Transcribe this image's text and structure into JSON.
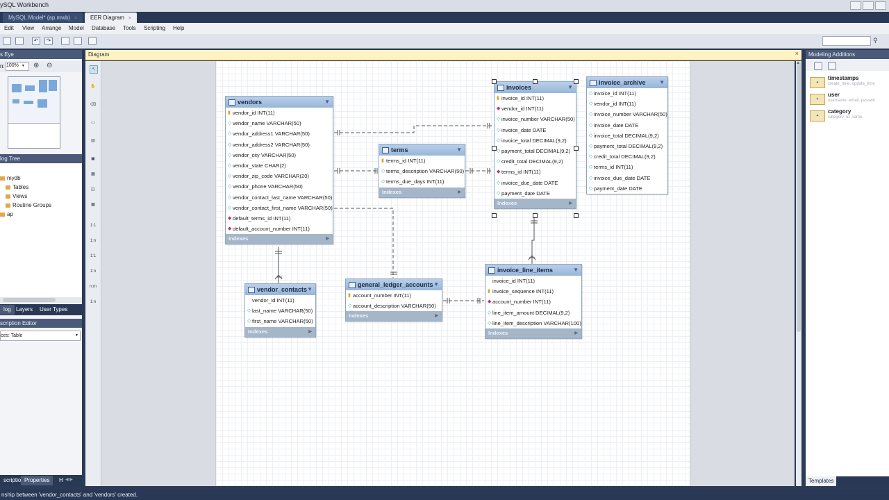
{
  "window": {
    "title": "ySQL Workbench"
  },
  "tabs": [
    {
      "label": "MySQL Model* (ap.mwb)",
      "close": "×"
    },
    {
      "label": "EER Diagram",
      "close": "×"
    }
  ],
  "menu": [
    "Edit",
    "View",
    "Arrange",
    "Model",
    "Database",
    "Tools",
    "Scripting",
    "Help"
  ],
  "left": {
    "birds_eye": "s Eye",
    "zoom_label": "n:",
    "zoom": "100%",
    "catalog_tree": "log Tree",
    "tree": [
      "mydb",
      "Tables",
      "Views",
      "Routine Groups",
      "ap"
    ],
    "bottom_tabs": [
      "log",
      "Layers",
      "User Types"
    ],
    "desc_editor": "scription Editor",
    "desc_select": "ces: Table",
    "footer_tabs": [
      "scription",
      "Properties",
      "H"
    ]
  },
  "diagram": {
    "header": "Diagram"
  },
  "tables": {
    "vendors": {
      "name": "vendors",
      "cols": [
        {
          "k": "pk",
          "t": "vendor_id INT(11)"
        },
        {
          "k": "c",
          "t": "vendor_name VARCHAR(50)"
        },
        {
          "k": "c",
          "t": "vendor_address1 VARCHAR(50)"
        },
        {
          "k": "c",
          "t": "vendor_address2 VARCHAR(50)"
        },
        {
          "k": "c",
          "t": "vendor_city VARCHAR(50)"
        },
        {
          "k": "c",
          "t": "vendor_state CHAR(2)"
        },
        {
          "k": "c",
          "t": "vendor_zip_code VARCHAR(20)"
        },
        {
          "k": "c",
          "t": "vendor_phone VARCHAR(50)"
        },
        {
          "k": "c",
          "t": "vendor_contact_last_name VARCHAR(50)"
        },
        {
          "k": "c",
          "t": "vendor_contact_first_name VARCHAR(50)"
        },
        {
          "k": "fk",
          "t": "default_terms_id INT(11)"
        },
        {
          "k": "fk",
          "t": "default_account_number INT(11)"
        }
      ]
    },
    "terms": {
      "name": "terms",
      "cols": [
        {
          "k": "pk",
          "t": "terms_id INT(11)"
        },
        {
          "k": "c",
          "t": "terms_description VARCHAR(50)"
        },
        {
          "k": "c",
          "t": "terms_due_days INT(11)"
        }
      ]
    },
    "invoices": {
      "name": "invoices",
      "cols": [
        {
          "k": "pk",
          "t": "invoice_id INT(11)"
        },
        {
          "k": "fk",
          "t": "vendor_id INT(11)"
        },
        {
          "k": "c",
          "t": "invoice_number VARCHAR(50)"
        },
        {
          "k": "c",
          "t": "invoice_date DATE"
        },
        {
          "k": "c",
          "t": "invoice_total DECIMAL(9,2)"
        },
        {
          "k": "c",
          "t": "payment_total DECIMAL(9,2)"
        },
        {
          "k": "c",
          "t": "credit_total DECIMAL(9,2)"
        },
        {
          "k": "fk",
          "t": "terms_id INT(11)"
        },
        {
          "k": "c",
          "t": "invoice_due_date DATE"
        },
        {
          "k": "c",
          "t": "payment_date DATE"
        }
      ]
    },
    "invoice_archive": {
      "name": "invoice_archive",
      "cols": [
        {
          "k": "c",
          "t": "invoice_id INT(11)"
        },
        {
          "k": "c",
          "t": "vendor_id INT(11)"
        },
        {
          "k": "c",
          "t": "invoice_number VARCHAR(50)"
        },
        {
          "k": "c",
          "t": "invoice_date DATE"
        },
        {
          "k": "c",
          "t": "invoice_total DECIMAL(9,2)"
        },
        {
          "k": "c",
          "t": "payment_total DECIMAL(9,2)"
        },
        {
          "k": "c",
          "t": "credit_total DECIMAL(9,2)"
        },
        {
          "k": "c",
          "t": "terms_id INT(11)"
        },
        {
          "k": "c",
          "t": "invoice_due_date DATE"
        },
        {
          "k": "c",
          "t": "payment_date DATE"
        }
      ]
    },
    "vendor_contacts": {
      "name": "vendor_contacts",
      "cols": [
        {
          "k": "",
          "t": "vendor_id INT(11)"
        },
        {
          "k": "c",
          "t": "last_name VARCHAR(50)"
        },
        {
          "k": "c",
          "t": "first_name VARCHAR(50)"
        }
      ]
    },
    "general_ledger_accounts": {
      "name": "general_ledger_accounts",
      "cols": [
        {
          "k": "pk",
          "t": "account_number INT(11)"
        },
        {
          "k": "c",
          "t": "account_description VARCHAR(50)"
        }
      ]
    },
    "invoice_line_items": {
      "name": "invoice_line_items",
      "cols": [
        {
          "k": "",
          "t": "invoice_id INT(11)"
        },
        {
          "k": "pk",
          "t": "invoice_sequence INT(11)"
        },
        {
          "k": "fk",
          "t": "account_number INT(11)"
        },
        {
          "k": "c",
          "t": "line_item_amount DECIMAL(9,2)"
        },
        {
          "k": "c",
          "t": "line_item_description VARCHAR(100)"
        }
      ]
    }
  },
  "indexes_label": "Indexes",
  "right": {
    "header": "Modeling Additions",
    "items": [
      {
        "name": "timestamps",
        "sub": "create_time, update_time"
      },
      {
        "name": "user",
        "sub": "username, email, passwo"
      },
      {
        "name": "category",
        "sub": "category_id, name"
      }
    ],
    "footer_tab": "Templates"
  },
  "status": "nship between 'vendor_contacts' and 'vendors' created."
}
